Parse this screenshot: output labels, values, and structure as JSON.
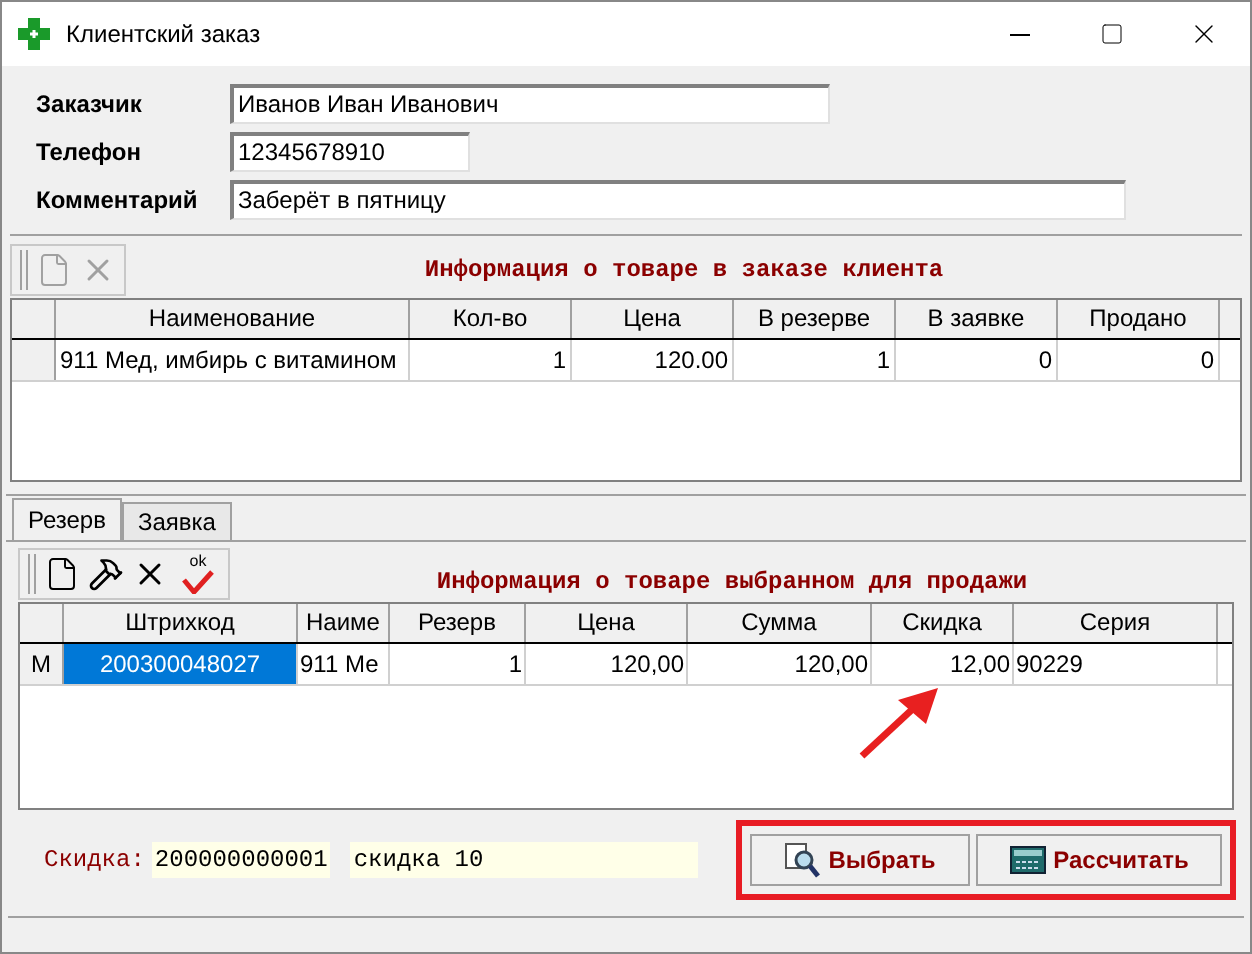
{
  "window": {
    "title": "Клиентский заказ"
  },
  "form": {
    "fields": [
      {
        "label": "Заказчик",
        "value": "Иванов Иван Иванович"
      },
      {
        "label": "Телефон",
        "value": "12345678910"
      },
      {
        "label": "Комментарий",
        "value": "Заберёт в пятницу"
      }
    ]
  },
  "order_panel": {
    "title": "Информация о товаре в заказе клиента",
    "toolbar": [
      {
        "kind": "new",
        "disabled": true
      },
      {
        "kind": "delete",
        "disabled": true
      }
    ],
    "table": {
      "columns": [
        {
          "label": "Наименование",
          "kind": "text"
        },
        {
          "label": "Кол-во",
          "kind": "number"
        },
        {
          "label": "Цена",
          "kind": "number"
        },
        {
          "label": "В резерве",
          "kind": "number"
        },
        {
          "label": "В заявке",
          "kind": "number"
        },
        {
          "label": "Продано",
          "kind": "number"
        }
      ],
      "rows": [
        {
          "cells": [
            "911 Мед, имбирь с витамином",
            "1",
            "120.00",
            "1",
            "0",
            "0"
          ]
        }
      ]
    }
  },
  "tabs": [
    {
      "label": "Резерв",
      "selected": true
    },
    {
      "label": "Заявка",
      "selected": false
    }
  ],
  "selection_panel": {
    "title": "Информация о товаре выбранном для продажи",
    "toolbar": [
      {
        "kind": "new",
        "disabled": false
      },
      {
        "kind": "tools",
        "disabled": false
      },
      {
        "kind": "delete",
        "disabled": false
      },
      {
        "kind": "confirm",
        "disabled": false,
        "label": "ok"
      }
    ],
    "table": {
      "columns": [
        {
          "label": "Штрихкод",
          "kind": "center"
        },
        {
          "label": "Наиме",
          "kind": "text"
        },
        {
          "label": "Резерв",
          "kind": "number"
        },
        {
          "label": "Цена",
          "kind": "number"
        },
        {
          "label": "Сумма",
          "kind": "number"
        },
        {
          "label": "Скидка",
          "kind": "number"
        },
        {
          "label": "Серия",
          "kind": "text"
        }
      ],
      "rows": [
        {
          "indicator": "M",
          "cells": [
            {
              "text": "200300048027",
              "selected": true
            },
            {
              "text": "911 Ме",
              "selected": false
            },
            {
              "text": "1",
              "selected": false
            },
            {
              "text": "120,00",
              "selected": false
            },
            {
              "text": "120,00",
              "selected": false
            },
            {
              "text": "12,00",
              "selected": false
            },
            {
              "text": "90229",
              "selected": false
            }
          ]
        }
      ]
    }
  },
  "discount": {
    "label": "Скидка:",
    "code": "200000000001",
    "name": "скидка 10"
  },
  "buttons": [
    {
      "label": "Выбрать",
      "kind": "select"
    },
    {
      "label": "Рассчитать",
      "kind": "calculate"
    }
  ]
}
